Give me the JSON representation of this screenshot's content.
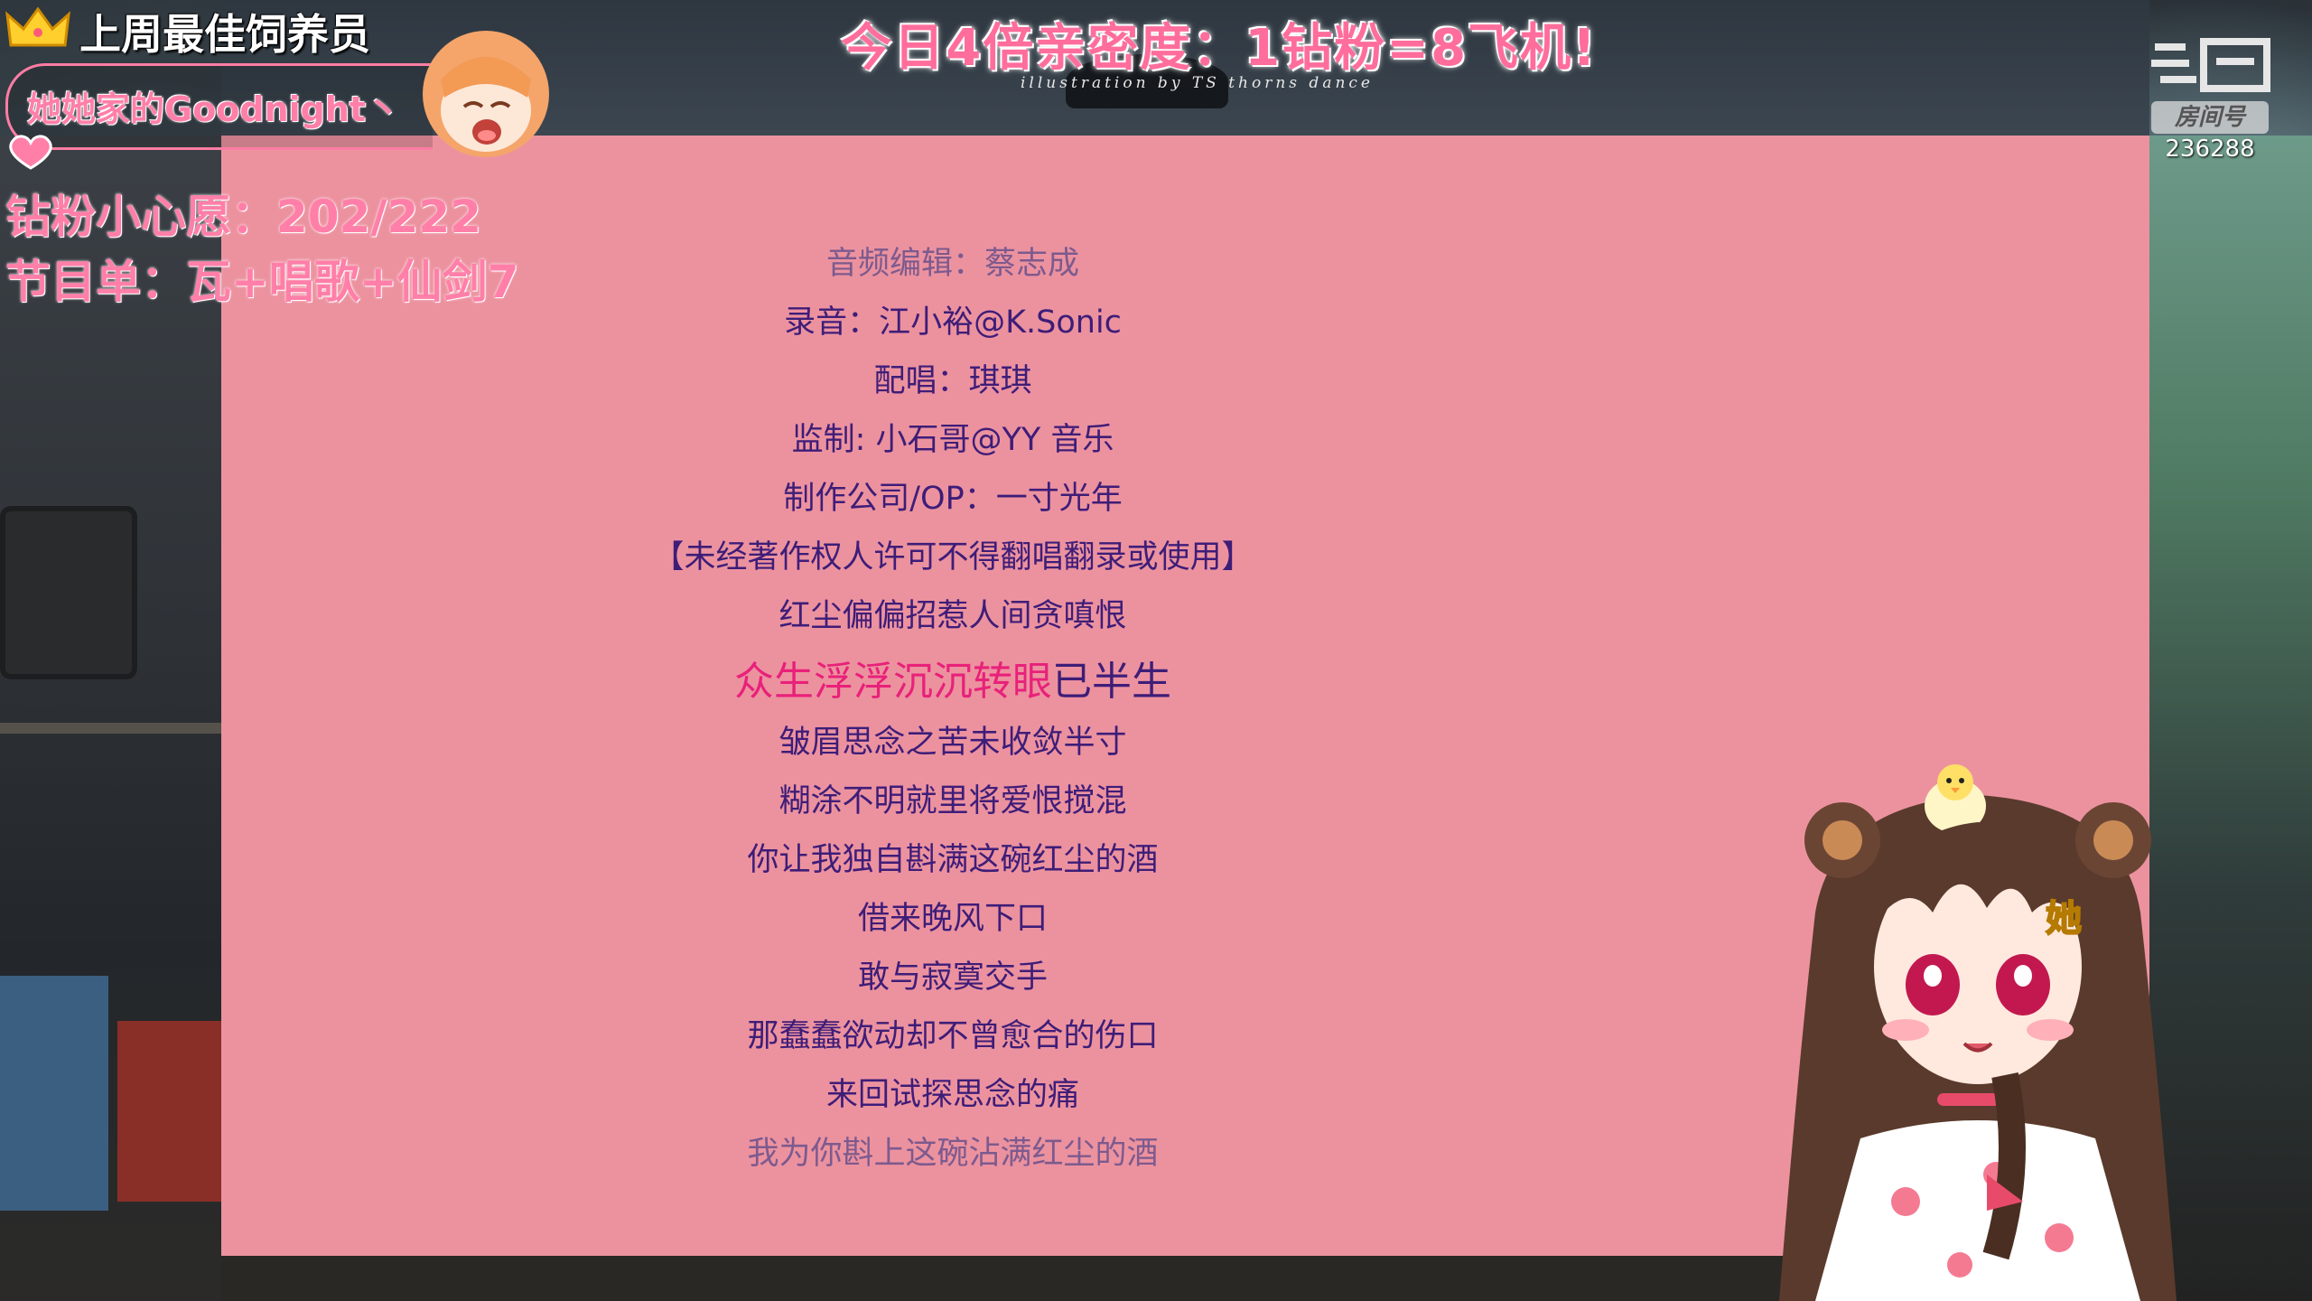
{
  "overlay": {
    "best_feeder_title": "上周最佳饲养员",
    "best_feeder_name": "她她家的Goodnight丶",
    "diamond_wish": "钻粉小心愿：202/222",
    "program_list": "节目单：瓦+唱歌+仙剑7"
  },
  "banner": {
    "promo": "今日4倍亲密度：1钻粉=8飞机!",
    "illustration_credit": "illustration by TS thorns dance"
  },
  "room": {
    "badge": "房间号",
    "number": "236288"
  },
  "lyrics": {
    "lines": [
      {
        "text": "音频编辑：蔡志成",
        "state": "faded"
      },
      {
        "text": "录音：江小裕@K.Sonic",
        "state": "normal"
      },
      {
        "text": "配唱：琪琪",
        "state": "normal"
      },
      {
        "text": "监制: 小石哥@YY 音乐",
        "state": "normal"
      },
      {
        "text": "制作公司/OP：一寸光年",
        "state": "normal"
      },
      {
        "text": "【未经著作权人许可不得翻唱翻录或使用】",
        "state": "normal"
      },
      {
        "text": "红尘偏偏招惹人间贪嗔恨",
        "state": "normal"
      },
      {
        "text": "众生浮浮沉沉转眼已半生",
        "state": "current",
        "sung": "众生浮浮沉沉转眼",
        "unsung": "已半生"
      },
      {
        "text": "皱眉思念之苦未收敛半寸",
        "state": "normal"
      },
      {
        "text": "糊涂不明就里将爱恨搅混",
        "state": "normal"
      },
      {
        "text": "你让我独自斟满这碗红尘的酒",
        "state": "normal"
      },
      {
        "text": "借来晚风下口",
        "state": "normal"
      },
      {
        "text": "敢与寂寞交手",
        "state": "normal"
      },
      {
        "text": "那蠢蠢欲动却不曾愈合的伤口",
        "state": "normal"
      },
      {
        "text": "来回试探思念的痛",
        "state": "normal"
      },
      {
        "text": "我为你斟上这碗沾满红尘的酒",
        "state": "faded"
      }
    ]
  },
  "colors": {
    "panel": "#ec929f",
    "lyric_text": "#3e1d78",
    "lyric_highlight": "#e8217a",
    "overlay_pink": "#ff7fa8"
  }
}
